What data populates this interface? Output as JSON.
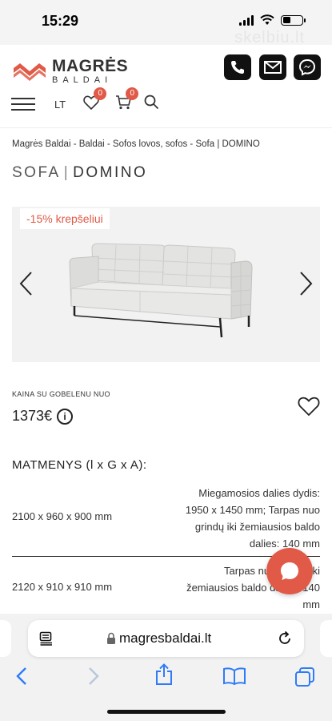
{
  "status_bar": {
    "time": "15:29",
    "watermark": "skelbiu.lt"
  },
  "brand": {
    "name": "MAGRĖS",
    "sub": "BALDAI",
    "accent": "#e05a47"
  },
  "header": {
    "language": "LT",
    "wishlist_count": "0",
    "cart_count": "0"
  },
  "breadcrumb": "Magrės Baldai - Baldai - Sofos lovos, sofos - Sofa | DOMINO",
  "title": {
    "part1": "SOFA",
    "part2": "DOMINO"
  },
  "gallery": {
    "promo": "-15% krepšeliui"
  },
  "price": {
    "label": "KAINA SU GOBELENU NUO",
    "value": "1373€"
  },
  "dimensions": {
    "title": "MATMENYS (l x G x A):",
    "rows": [
      {
        "size": "2100 x 960 x 900 mm",
        "desc": [
          "Miegamosios dalies dydis:",
          "1950 x 1450 mm; Tarpas nuo",
          "grindų iki žemiausios baldo",
          "dalies: 140 mm"
        ]
      },
      {
        "size": "2120 x 910 x 910 mm",
        "desc": [
          "Tarpas nuo grindų iki",
          "žemiausios baldo dalies: 140",
          "mm"
        ]
      }
    ]
  },
  "browser": {
    "url": "magresbaldai.lt"
  }
}
